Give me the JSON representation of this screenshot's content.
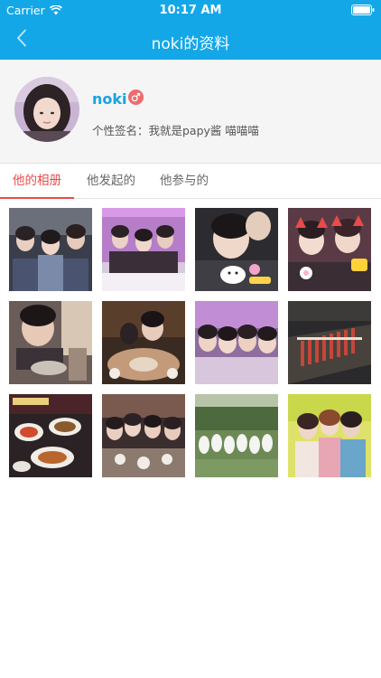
{
  "status_bar": {
    "carrier": "Carrier",
    "time": "10:17 AM",
    "wifi_icon": "wifi-icon",
    "battery_icon": "battery-icon"
  },
  "nav": {
    "back_icon": "chevron-left-icon",
    "title": "noki的资料"
  },
  "profile": {
    "username": "noki",
    "gender_icon": "male-icon",
    "signature": "个性签名：我就是papy酱 喵喵喵"
  },
  "tabs": [
    {
      "label": "他的相册",
      "active": true
    },
    {
      "label": "他发起的",
      "active": false
    },
    {
      "label": "他参与的",
      "active": false
    }
  ],
  "colors": {
    "nav_bg": "#14a7e8",
    "username": "#19a3de",
    "active_tab": "#e64b4b",
    "gender_badge": "#ee6b6b"
  },
  "photos": [
    {
      "name": "photo-group-friends"
    },
    {
      "name": "photo-purple-room"
    },
    {
      "name": "photo-boy-with-stickers"
    },
    {
      "name": "photo-cat-ear-stickers"
    },
    {
      "name": "photo-eating-noodles"
    },
    {
      "name": "photo-restaurant-table"
    },
    {
      "name": "photo-four-faces-purple"
    },
    {
      "name": "photo-bbq-skewers"
    },
    {
      "name": "photo-food-spread"
    },
    {
      "name": "photo-dinner-group"
    },
    {
      "name": "photo-white-dogs"
    },
    {
      "name": "photo-girls-sitting"
    }
  ]
}
